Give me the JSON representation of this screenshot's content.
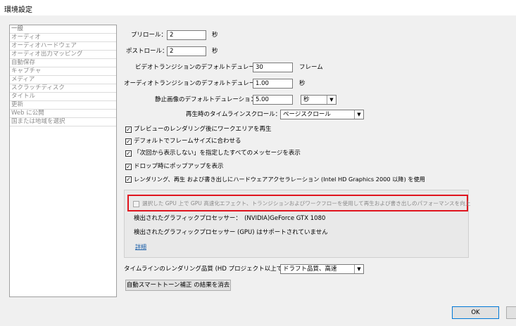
{
  "window": {
    "title": "環境設定"
  },
  "sidebar": {
    "items": [
      {
        "label": "一般"
      },
      {
        "label": "オーディオ"
      },
      {
        "label": "オーディオハードウェア"
      },
      {
        "label": "オーディオ出力マッピング"
      },
      {
        "label": "自動保存"
      },
      {
        "label": "キャプチャ"
      },
      {
        "label": "メディア"
      },
      {
        "label": "スクラッチディスク"
      },
      {
        "label": "タイトル"
      },
      {
        "label": "更新"
      },
      {
        "label": "Web に公開"
      },
      {
        "label": "国または地域を選択"
      }
    ]
  },
  "general": {
    "preroll": {
      "label": "プリロール：",
      "value": "2",
      "unit": "秒"
    },
    "postroll": {
      "label": "ポストロール：",
      "value": "2",
      "unit": "秒"
    },
    "video_transition": {
      "label": "ビデオトランジションのデフォルトデュレーション：",
      "value": "30",
      "unit": "フレーム"
    },
    "audio_transition": {
      "label": "オーディオトランジションのデフォルトデュレーション：",
      "value": "1.00",
      "unit": "秒"
    },
    "still_image": {
      "label": "静止画像のデフォルトデュレーション：",
      "value": "5.00",
      "unit_select": "秒"
    },
    "timeline_scroll": {
      "label": "再生時のタイムラインスクロール：",
      "value": "ページスクロール"
    },
    "checkboxes": [
      {
        "label": "プレビューのレンダリング後にワークエリアを再生",
        "checked": true
      },
      {
        "label": "デフォルトでフレームサイズに合わせる",
        "checked": true
      },
      {
        "label": "「次回から表示しない」を指定したすべてのメッセージを表示",
        "checked": true
      },
      {
        "label": "ドロップ時にポップアップを表示",
        "checked": true
      },
      {
        "label": "レンダリング、再生 および書き出しにハードウェアアクセラレーション (Intel HD Graphics 2000 以降) を使用",
        "checked": true
      }
    ],
    "gpu": {
      "checkbox_label": "選択した GPU 上で GPU 高速化エフェクト、トランジションおよびワークフローを使用して再生および書き出しのパフォーマンスを向上",
      "detected_processor": "検出されたグラフィックプロセッサー：　(NVIDIA)GeForce GTX 1080",
      "gpu_unsupported": "検出されたグラフィックプロセッサー (GPU) はサポートされていません",
      "details_link": "詳細"
    },
    "render_quality": {
      "label": "タイムラインのレンダリング品質 (HD プロジェクト以上で有効)：",
      "value": "ドラフト品質、高速"
    },
    "smart_tone_button": "自動スマートトーン補正 の結果を消去"
  },
  "footer": {
    "ok": "OK"
  },
  "colors": {
    "highlight": "#e0141e",
    "link": "#1a5ea8"
  }
}
